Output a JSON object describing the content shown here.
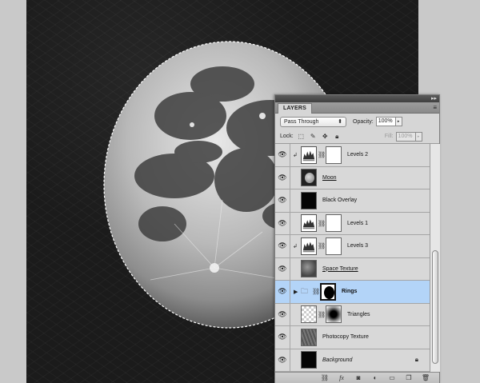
{
  "panel": {
    "tab_label": "LAYERS",
    "blend_mode": "Pass Through",
    "opacity_label": "Opacity:",
    "opacity_value": "100%",
    "lock_label": "Lock:",
    "fill_label": "Fill:",
    "fill_value": "100%"
  },
  "layers": [
    {
      "name": "Levels 2"
    },
    {
      "name": "Moon"
    },
    {
      "name": "Black Overlay"
    },
    {
      "name": "Levels 1"
    },
    {
      "name": "Levels 3"
    },
    {
      "name": "Space Texture"
    },
    {
      "name": "Rings"
    },
    {
      "name": "Triangles"
    },
    {
      "name": "Photocopy Texture"
    },
    {
      "name": "Background"
    }
  ],
  "icons": {
    "eye": "eye-icon",
    "link": "chain-link-icon",
    "lock": "lock-icon",
    "folder": "folder-icon"
  },
  "footer_icons": [
    "link-layers-icon",
    "fx-icon",
    "add-mask-icon",
    "adjustment-layer-icon",
    "new-group-icon",
    "new-layer-icon",
    "trash-icon"
  ]
}
